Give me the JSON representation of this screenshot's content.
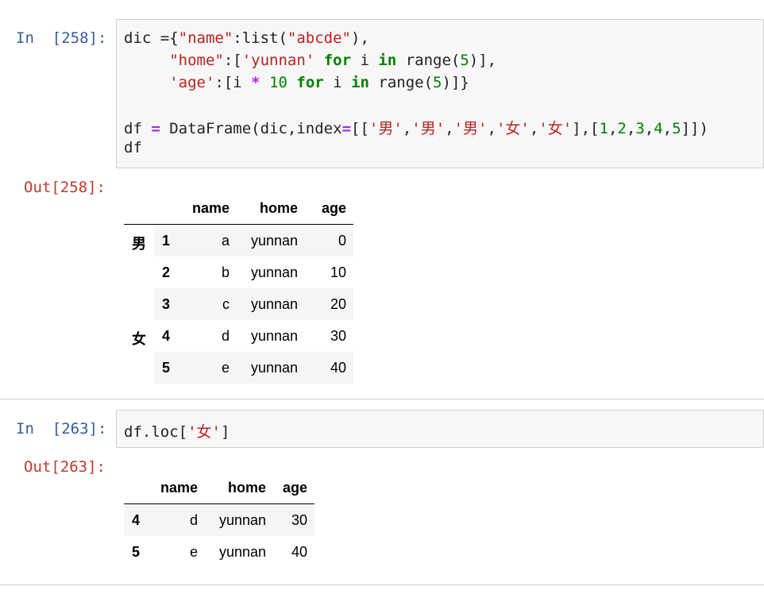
{
  "cell1": {
    "in_prompt": "In  [258]:",
    "code": {
      "l1": {
        "a": "dic ={",
        "b": "\"name\"",
        "c": ":list(",
        "d": "\"abcde\"",
        "e": "),"
      },
      "l2": {
        "a": "     ",
        "b": "\"home\"",
        "c": ":[",
        "d": "'yunnan'",
        "e": " ",
        "f": "for",
        "g": " i ",
        "h": "in",
        "i": " range(",
        "j": "5",
        "k": ")],"
      },
      "l3": {
        "a": "     ",
        "b": "'age'",
        "c": ":[i ",
        "d": "*",
        "e": " ",
        "f": "10",
        "g": " ",
        "h": "for",
        "i": " i ",
        "j": "in",
        "k": " range(",
        "l": "5",
        "m": ")]}"
      },
      "l5": {
        "a": "df ",
        "b": "=",
        "c": " DataFrame(dic,index",
        "d": "=",
        "e": "[[",
        "f": "'男'",
        "g": ",",
        "h": "'男'",
        "i": ",",
        "j": "'男'",
        "k": ",",
        "l": "'女'",
        "m": ",",
        "n": "'女'",
        "o": "],[",
        "p": "1",
        "q": ",",
        "r": "2",
        "s": ",",
        "t": "3",
        "u": ",",
        "v": "4",
        "w": ",",
        "x": "5",
        "y": "]])"
      },
      "l6": "df"
    },
    "out_prompt": "Out[258]:",
    "table": {
      "columns": [
        "name",
        "home",
        "age"
      ],
      "level0": [
        "男",
        "女"
      ],
      "rows": [
        {
          "idx": "1",
          "name": "a",
          "home": "yunnan",
          "age": "0"
        },
        {
          "idx": "2",
          "name": "b",
          "home": "yunnan",
          "age": "10"
        },
        {
          "idx": "3",
          "name": "c",
          "home": "yunnan",
          "age": "20"
        },
        {
          "idx": "4",
          "name": "d",
          "home": "yunnan",
          "age": "30"
        },
        {
          "idx": "5",
          "name": "e",
          "home": "yunnan",
          "age": "40"
        }
      ]
    }
  },
  "cell2": {
    "in_prompt": "In  [263]:",
    "code": {
      "a": "df.loc[",
      "b": "'女'",
      "c": "]"
    },
    "out_prompt": "Out[263]:",
    "table": {
      "columns": [
        "name",
        "home",
        "age"
      ],
      "rows": [
        {
          "idx": "4",
          "name": "d",
          "home": "yunnan",
          "age": "30"
        },
        {
          "idx": "5",
          "name": "e",
          "home": "yunnan",
          "age": "40"
        }
      ]
    }
  }
}
